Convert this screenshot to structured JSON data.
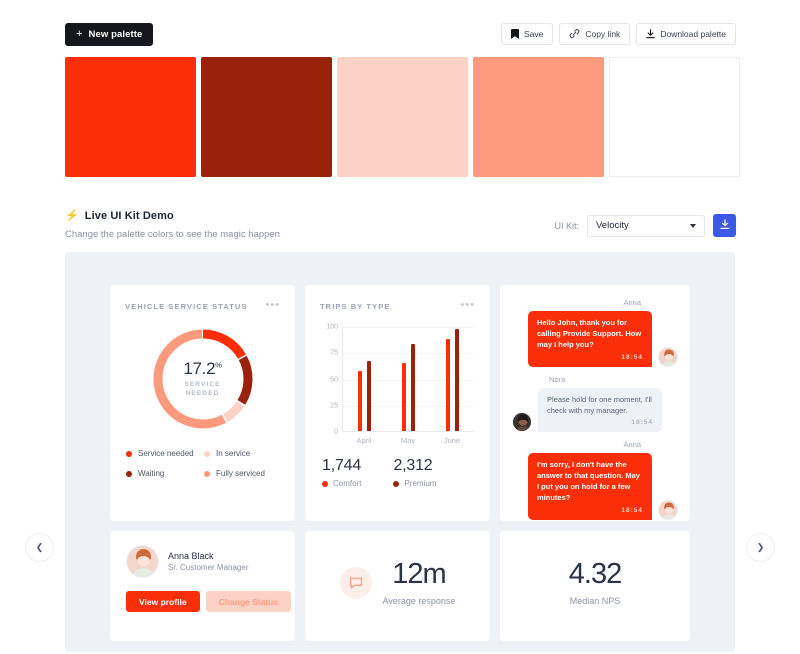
{
  "toolbar": {
    "new_palette_label": "New palette",
    "new_palette_icon": "plus-icon",
    "save_label": "Save",
    "copy_link_label": "Copy link",
    "download_palette_label": "Download palette"
  },
  "palette": {
    "swatches": [
      {
        "name": "swatch-primary",
        "hex": "#FA2E09"
      },
      {
        "name": "swatch-dark",
        "hex": "#99230A"
      },
      {
        "name": "swatch-light",
        "hex": "#FDD2C6"
      },
      {
        "name": "swatch-salmon",
        "hex": "#FD9A7E"
      },
      {
        "name": "swatch-white",
        "hex": "#FFFFFF"
      }
    ]
  },
  "demo": {
    "title": "Live UI Kit Demo",
    "bolt_icon": "bolt-icon",
    "subtitle": "Change the palette colors to see the magic happen",
    "uikit_label": "UI Kit:",
    "uikit_value": "Velocity",
    "uikit_options": [
      "Velocity"
    ],
    "download_icon": "download-icon",
    "prev_icon": "chevron-left-icon",
    "next_icon": "chevron-right-icon"
  },
  "service_card": {
    "title": "Vehicle service status",
    "menu_icon": "ellipsis-icon",
    "value": "17.2",
    "value_unit": "%",
    "value_label_line1": "SERVICE",
    "value_label_line2": "NEEDED",
    "segments": [
      {
        "label": "Service needed",
        "value": 17.2,
        "color": "#FA2E09"
      },
      {
        "label": "Waiting",
        "value": 17.0,
        "color": "#99230A"
      },
      {
        "label": "In service",
        "value": 8.0,
        "color": "#FDD2C6"
      },
      {
        "label": "Fully serviced",
        "value": 57.8,
        "color": "#FD9A7E"
      }
    ],
    "legend": [
      {
        "label": "Service needed",
        "color": "#FA2E09"
      },
      {
        "label": "In service",
        "color": "#FDD2C6"
      },
      {
        "label": "Waiting",
        "color": "#99230A"
      },
      {
        "label": "Fully serviced",
        "color": "#FD9A7E"
      }
    ]
  },
  "trips_card": {
    "title": "Trips by type",
    "menu_icon": "ellipsis-icon",
    "kpis": [
      {
        "value": "1,744",
        "label": "Comfort",
        "color": "#FA2E09"
      },
      {
        "value": "2,312",
        "label": "Premium",
        "color": "#99230A"
      }
    ]
  },
  "chart_data": {
    "type": "bar",
    "title": "Trips by type",
    "categories": [
      "April",
      "May",
      "June"
    ],
    "series": [
      {
        "name": "Comfort",
        "color": "#FA2E09",
        "values": [
          57,
          65,
          88
        ]
      },
      {
        "name": "Premium",
        "color": "#99230A",
        "values": [
          67,
          83,
          97
        ]
      }
    ],
    "xlabel": "",
    "ylabel": "",
    "ylim": [
      0,
      100
    ],
    "yticks": [
      0,
      25,
      50,
      75,
      100
    ],
    "grid": true,
    "legend": "below"
  },
  "chat_card": {
    "messages": [
      {
        "sender": "Anna",
        "side": "right",
        "text": "Hello John, thank you for calling Provide Support. How may I help you?",
        "time": "18:54",
        "avatar": "avatar-anna"
      },
      {
        "sender": "Nora",
        "side": "left",
        "text": "Please hold for one moment, I'll check with my manager.",
        "time": "18:54",
        "avatar": "avatar-nora"
      },
      {
        "sender": "Anna",
        "side": "right",
        "text": "I'm sorry, I don't have the answer to that question. May I put you on hold for a few minutes?",
        "time": "18:54",
        "avatar": "avatar-anna"
      }
    ]
  },
  "profile_card": {
    "avatar": "avatar-anna-black",
    "name": "Anna Black",
    "role": "Sr. Customer Manager",
    "primary_button": "View profile",
    "secondary_button": "Change Status"
  },
  "avg_card": {
    "icon": "chat-bubble-icon",
    "value": "12m",
    "label": "Average response"
  },
  "nps_card": {
    "value": "4.32",
    "label": "Median NPS"
  }
}
